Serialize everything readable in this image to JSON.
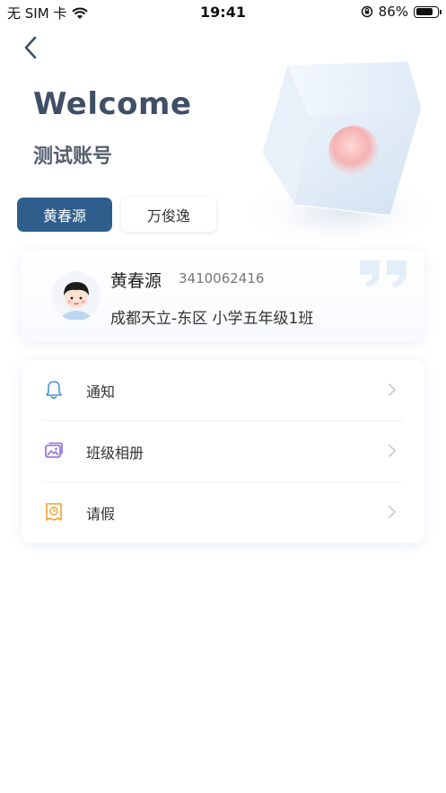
{
  "status_bar": {
    "carrier": "无 SIM 卡",
    "time": "19:41",
    "battery_text": "86%",
    "battery_level": 0.86
  },
  "header": {
    "welcome": "Welcome",
    "account_name": "测试账号"
  },
  "tabs": [
    {
      "label": "黄春源",
      "active": true
    },
    {
      "label": "万俊逸",
      "active": false
    }
  ],
  "profile": {
    "name": "黄春源",
    "id": "3410062416",
    "school": "成都天立-东区   小学五年级1班"
  },
  "menu": {
    "items": [
      {
        "label": "通知",
        "icon": "bell-icon"
      },
      {
        "label": "班级相册",
        "icon": "album-icon"
      },
      {
        "label": "请假",
        "icon": "leave-icon"
      }
    ]
  },
  "colors": {
    "accent": "#2f5e8c",
    "title": "#3f4f66",
    "icon_blue": "#4a90d9",
    "icon_purple": "#8a6bd8",
    "icon_orange": "#f0a030"
  }
}
